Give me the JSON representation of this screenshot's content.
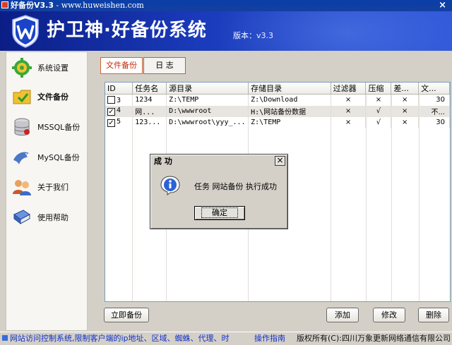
{
  "window": {
    "title": "好备份V3.3",
    "title_sep": " - ",
    "url": "www.huweishen.com",
    "close_glyph": "×"
  },
  "banner": {
    "app_title": "护卫神·好备份系统",
    "version": "版本：v3.3"
  },
  "sidebar": {
    "items": [
      {
        "label": "系统设置",
        "icon": "gear-icon"
      },
      {
        "label": "文件备份",
        "icon": "folder-backup-icon"
      },
      {
        "label": "MSSQL备份",
        "icon": "database-icon"
      },
      {
        "label": "MySQL备份",
        "icon": "dolphin-icon"
      },
      {
        "label": "关于我们",
        "icon": "users-icon"
      },
      {
        "label": "使用帮助",
        "icon": "book-icon"
      }
    ]
  },
  "tabs": [
    {
      "label": "文件备份",
      "active": true
    },
    {
      "label": "日 志",
      "active": false
    }
  ],
  "table": {
    "columns": [
      "ID",
      "任务名",
      "源目录",
      "存储目录",
      "过滤器",
      "压缩",
      "差...",
      "文..."
    ],
    "rows": [
      {
        "checked": false,
        "id": "3",
        "name": "1234",
        "source": "Z:\\TEMP",
        "target": "Z:\\Download",
        "filter": "×",
        "compress": "×",
        "diff": "×",
        "file": "30"
      },
      {
        "checked": true,
        "id": "4",
        "name": "网...",
        "source": "D:\\wwwroot",
        "target": "H:\\网站备份数据",
        "filter": "×",
        "compress": "√",
        "diff": "×",
        "file": "不..."
      },
      {
        "checked": true,
        "id": "5",
        "name": "123...",
        "source": "D:\\wwwroot\\yyy_...",
        "target": "Z:\\TEMP",
        "filter": "×",
        "compress": "√",
        "diff": "×",
        "file": "30"
      }
    ]
  },
  "buttons": {
    "backup_now": "立即备份",
    "add": "添加",
    "edit": "修改",
    "delete": "删除"
  },
  "statusbar": {
    "marquee": "网站访问控制系统,限制客户端的ip地址、区域、蜘蛛、代理、时",
    "help": "操作指南",
    "copyright": "版权所有(C):四川万象更新网络通信有限公司"
  },
  "dialog": {
    "title": "成 功",
    "close_glyph": "×",
    "message": "任务 网站备份 执行成功",
    "ok_label": "确定"
  },
  "colors": {
    "banner": "#1a3bbb",
    "accent_tab": "#c42a08",
    "status_link": "#1030c8"
  }
}
